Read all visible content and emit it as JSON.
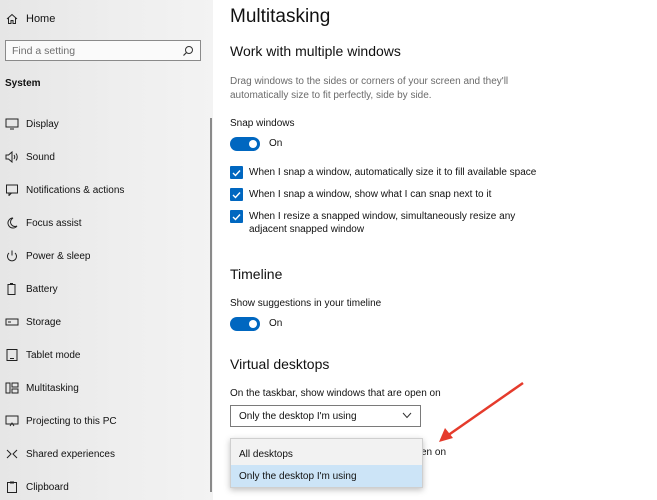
{
  "sidebar": {
    "home_label": "Home",
    "search_placeholder": "Find a setting",
    "section_title": "System",
    "items": [
      {
        "label": "Display",
        "icon": "display-icon"
      },
      {
        "label": "Sound",
        "icon": "sound-icon"
      },
      {
        "label": "Notifications & actions",
        "icon": "notifications-icon"
      },
      {
        "label": "Focus assist",
        "icon": "focus-assist-icon"
      },
      {
        "label": "Power & sleep",
        "icon": "power-icon"
      },
      {
        "label": "Battery",
        "icon": "battery-icon"
      },
      {
        "label": "Storage",
        "icon": "storage-icon"
      },
      {
        "label": "Tablet mode",
        "icon": "tablet-icon"
      },
      {
        "label": "Multitasking",
        "icon": "multitasking-icon"
      },
      {
        "label": "Projecting to this PC",
        "icon": "projecting-icon"
      },
      {
        "label": "Shared experiences",
        "icon": "shared-icon"
      },
      {
        "label": "Clipboard",
        "icon": "clipboard-icon"
      }
    ]
  },
  "main": {
    "title": "Multitasking",
    "windows": {
      "heading": "Work with multiple windows",
      "description": "Drag windows to the sides or corners of your screen and they'll automatically size to fit perfectly, side by side.",
      "snap_label": "Snap windows",
      "snap_state": "On",
      "checkboxes": [
        "When I snap a window, automatically size it to fill available space",
        "When I snap a window, show what I can snap next to it",
        "When I resize a snapped window, simultaneously resize any adjacent snapped window"
      ]
    },
    "timeline": {
      "heading": "Timeline",
      "suggest_label": "Show suggestions in your timeline",
      "suggest_state": "On"
    },
    "virtual": {
      "heading": "Virtual desktops",
      "taskbar_label": "On the taskbar, show windows that are open on",
      "selected": "Only the desktop I'm using",
      "options": [
        "All desktops",
        "Only the desktop I'm using"
      ],
      "peek_text": "en on"
    }
  },
  "colors": {
    "accent": "#0067c0",
    "selected_option": "#cce4f7",
    "annotation_arrow": "#e53b2c"
  }
}
